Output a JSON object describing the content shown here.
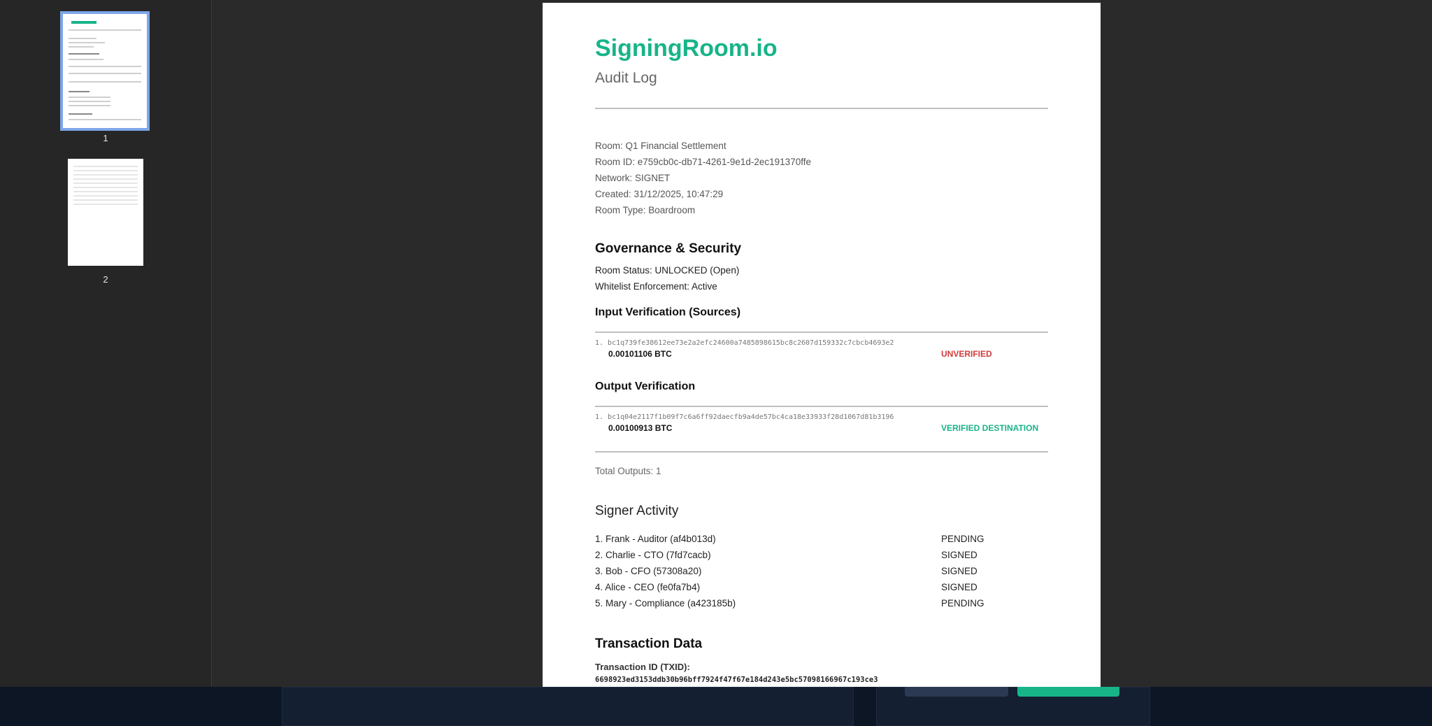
{
  "viewer": {
    "thumbnails": [
      {
        "label": "1"
      },
      {
        "label": "2"
      }
    ]
  },
  "doc": {
    "brand": "SigningRoom.io",
    "subtitle": "Audit Log",
    "meta": [
      "Room: Q1 Financial Settlement",
      "Room ID: e759cb0c-db71-4261-9e1d-2ec191370ffe",
      "Network: SIGNET",
      "Created: 31/12/2025, 10:47:29",
      "Room Type: Boardroom"
    ],
    "governance": {
      "heading": "Governance & Security",
      "status": "Room Status: UNLOCKED (Open)",
      "whitelist": "Whitelist Enforcement: Active"
    },
    "inputs": {
      "heading": "Input Verification (Sources)",
      "items": [
        {
          "address": "1. bc1q739fe38612ee73e2a2efc24600a7485898615bc8c2607d159332c7cbcb4693e2",
          "amount": "0.00101106 BTC",
          "status": "UNVERIFIED"
        }
      ]
    },
    "outputs": {
      "heading": "Output Verification",
      "items": [
        {
          "address": "1. bc1q04e2117f1b09f7c6a6ff92daecfb9a4de57bc4ca18e33933f28d1067d81b3196",
          "amount": "0.00100913 BTC",
          "status": "VERIFIED DESTINATION"
        }
      ],
      "total": "Total Outputs: 1"
    },
    "signers": {
      "heading": "Signer Activity",
      "items": [
        {
          "name": "1. Frank - Auditor (af4b013d)",
          "status": "PENDING"
        },
        {
          "name": "2. Charlie - CTO (7fd7cacb)",
          "status": "SIGNED"
        },
        {
          "name": "3. Bob - CFO (57308a20)",
          "status": "SIGNED"
        },
        {
          "name": "4. Alice - CEO (fe0fa7b4)",
          "status": "SIGNED"
        },
        {
          "name": "5. Mary - Compliance (a423185b)",
          "status": "PENDING"
        }
      ]
    },
    "transaction": {
      "heading": "Transaction Data",
      "txid_label": "Transaction ID (TXID):",
      "txid": "6698923ed3153ddb30b96bff7924f47f67e184d243e5bc57098166967c193ce3"
    }
  },
  "colors": {
    "brand": "#18b489",
    "unverified": "#d23b3b",
    "verified": "#18b489",
    "thumb_selected": "#7da6e8"
  }
}
